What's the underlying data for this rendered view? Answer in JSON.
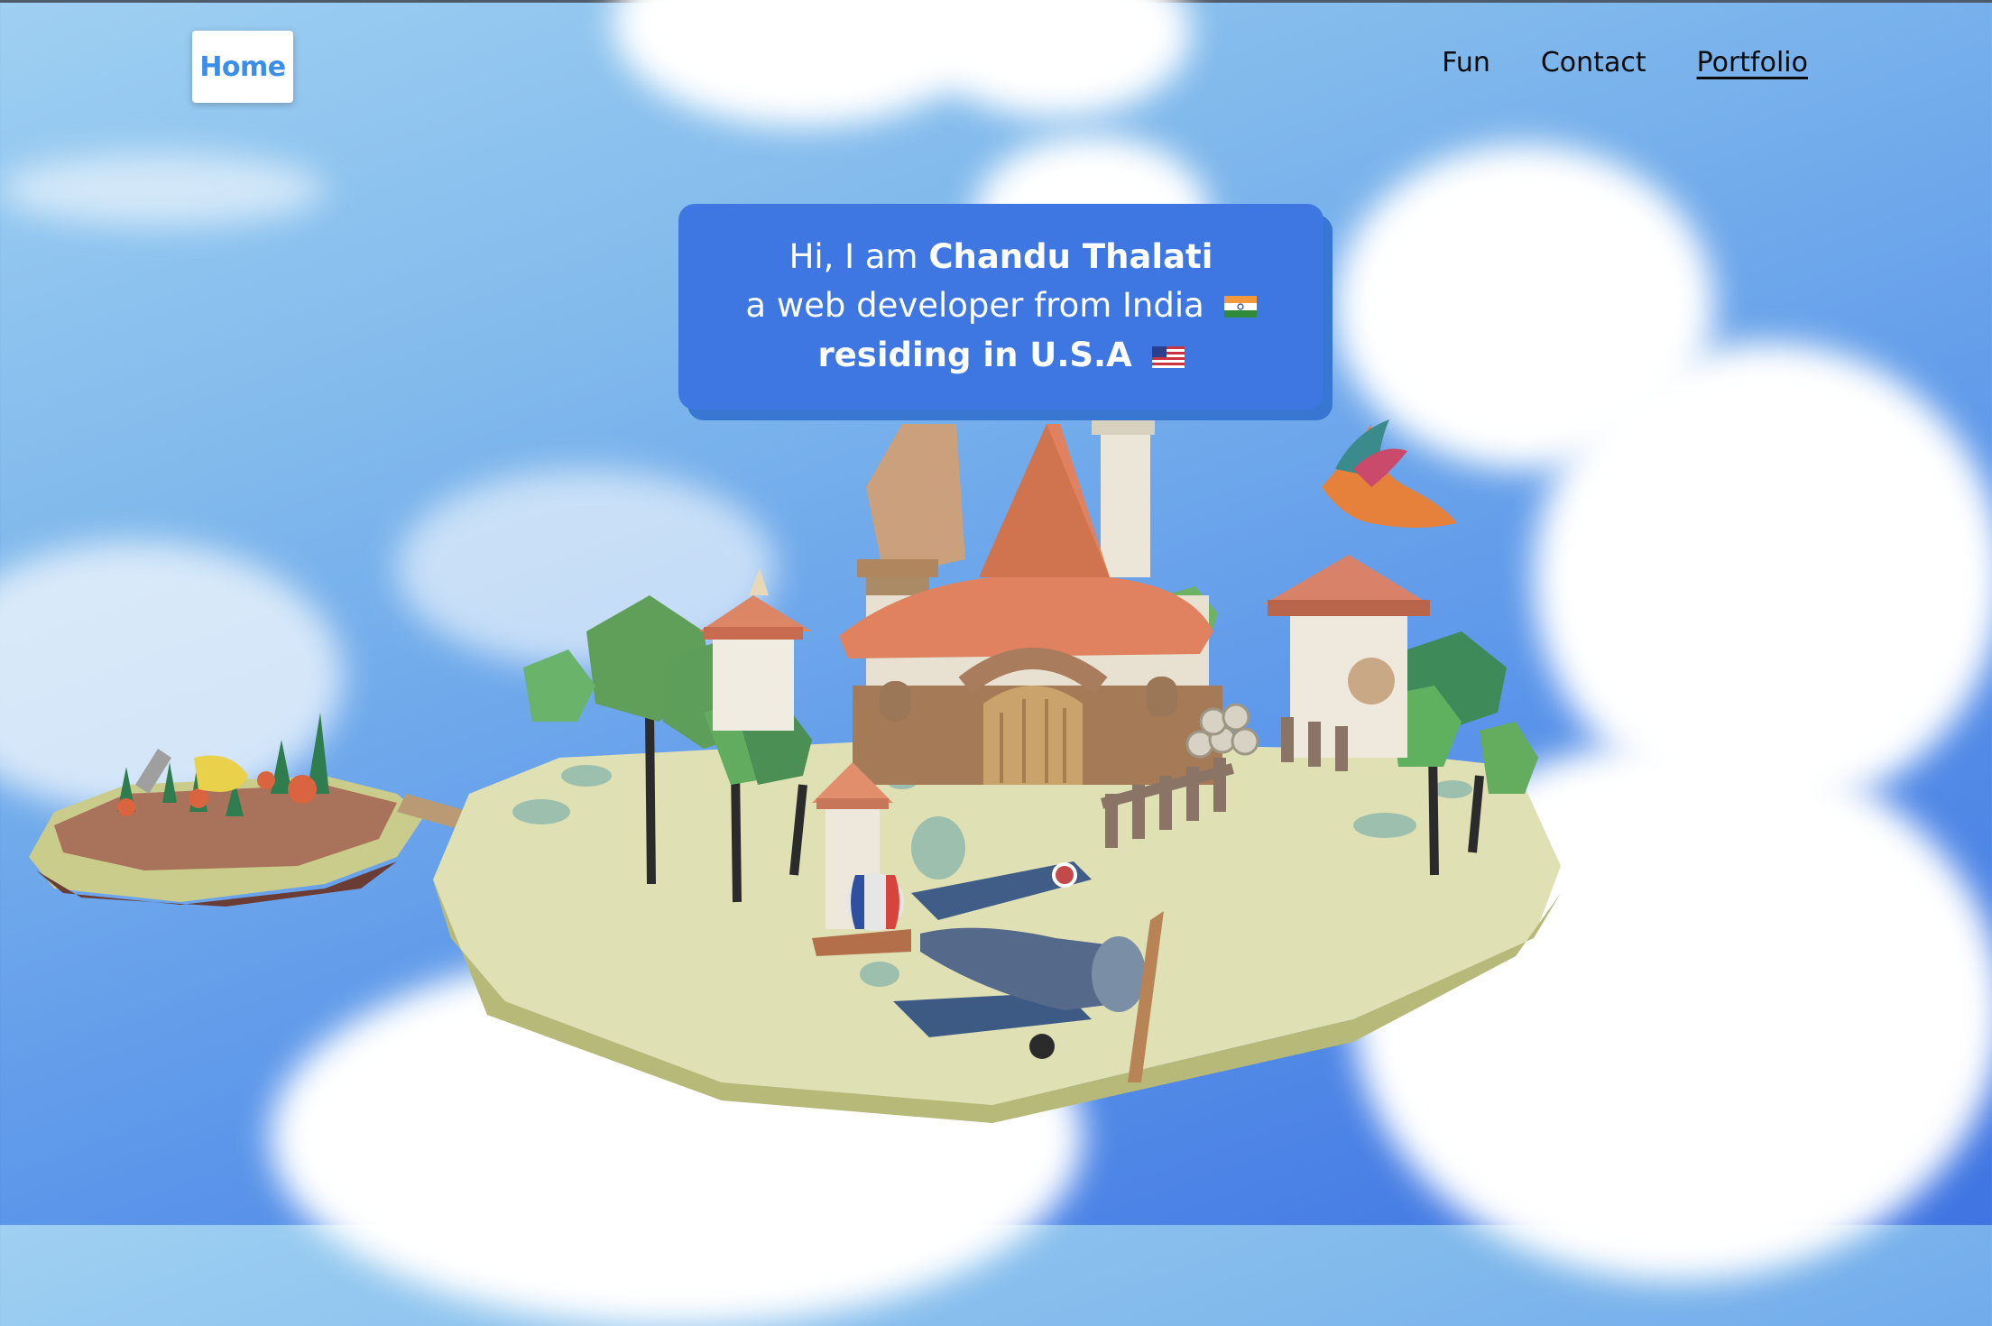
{
  "nav": {
    "logo_label": "Home",
    "links": [
      "Fun",
      "Contact",
      "Portfolio"
    ],
    "active_link": "Portfolio"
  },
  "intro": {
    "greeting": "Hi, I am",
    "name": "Chandu Thalati",
    "line2": "a web developer from India",
    "line3": "residing in U.S.A",
    "flag_india_icon": "india-flag-icon",
    "flag_usa_icon": "usa-flag-icon"
  },
  "colors": {
    "accent": "#3f77e2",
    "logo_text": "#3a8de9",
    "sky_top": "#9fd0f2",
    "sky_right": "#3f74e2"
  }
}
